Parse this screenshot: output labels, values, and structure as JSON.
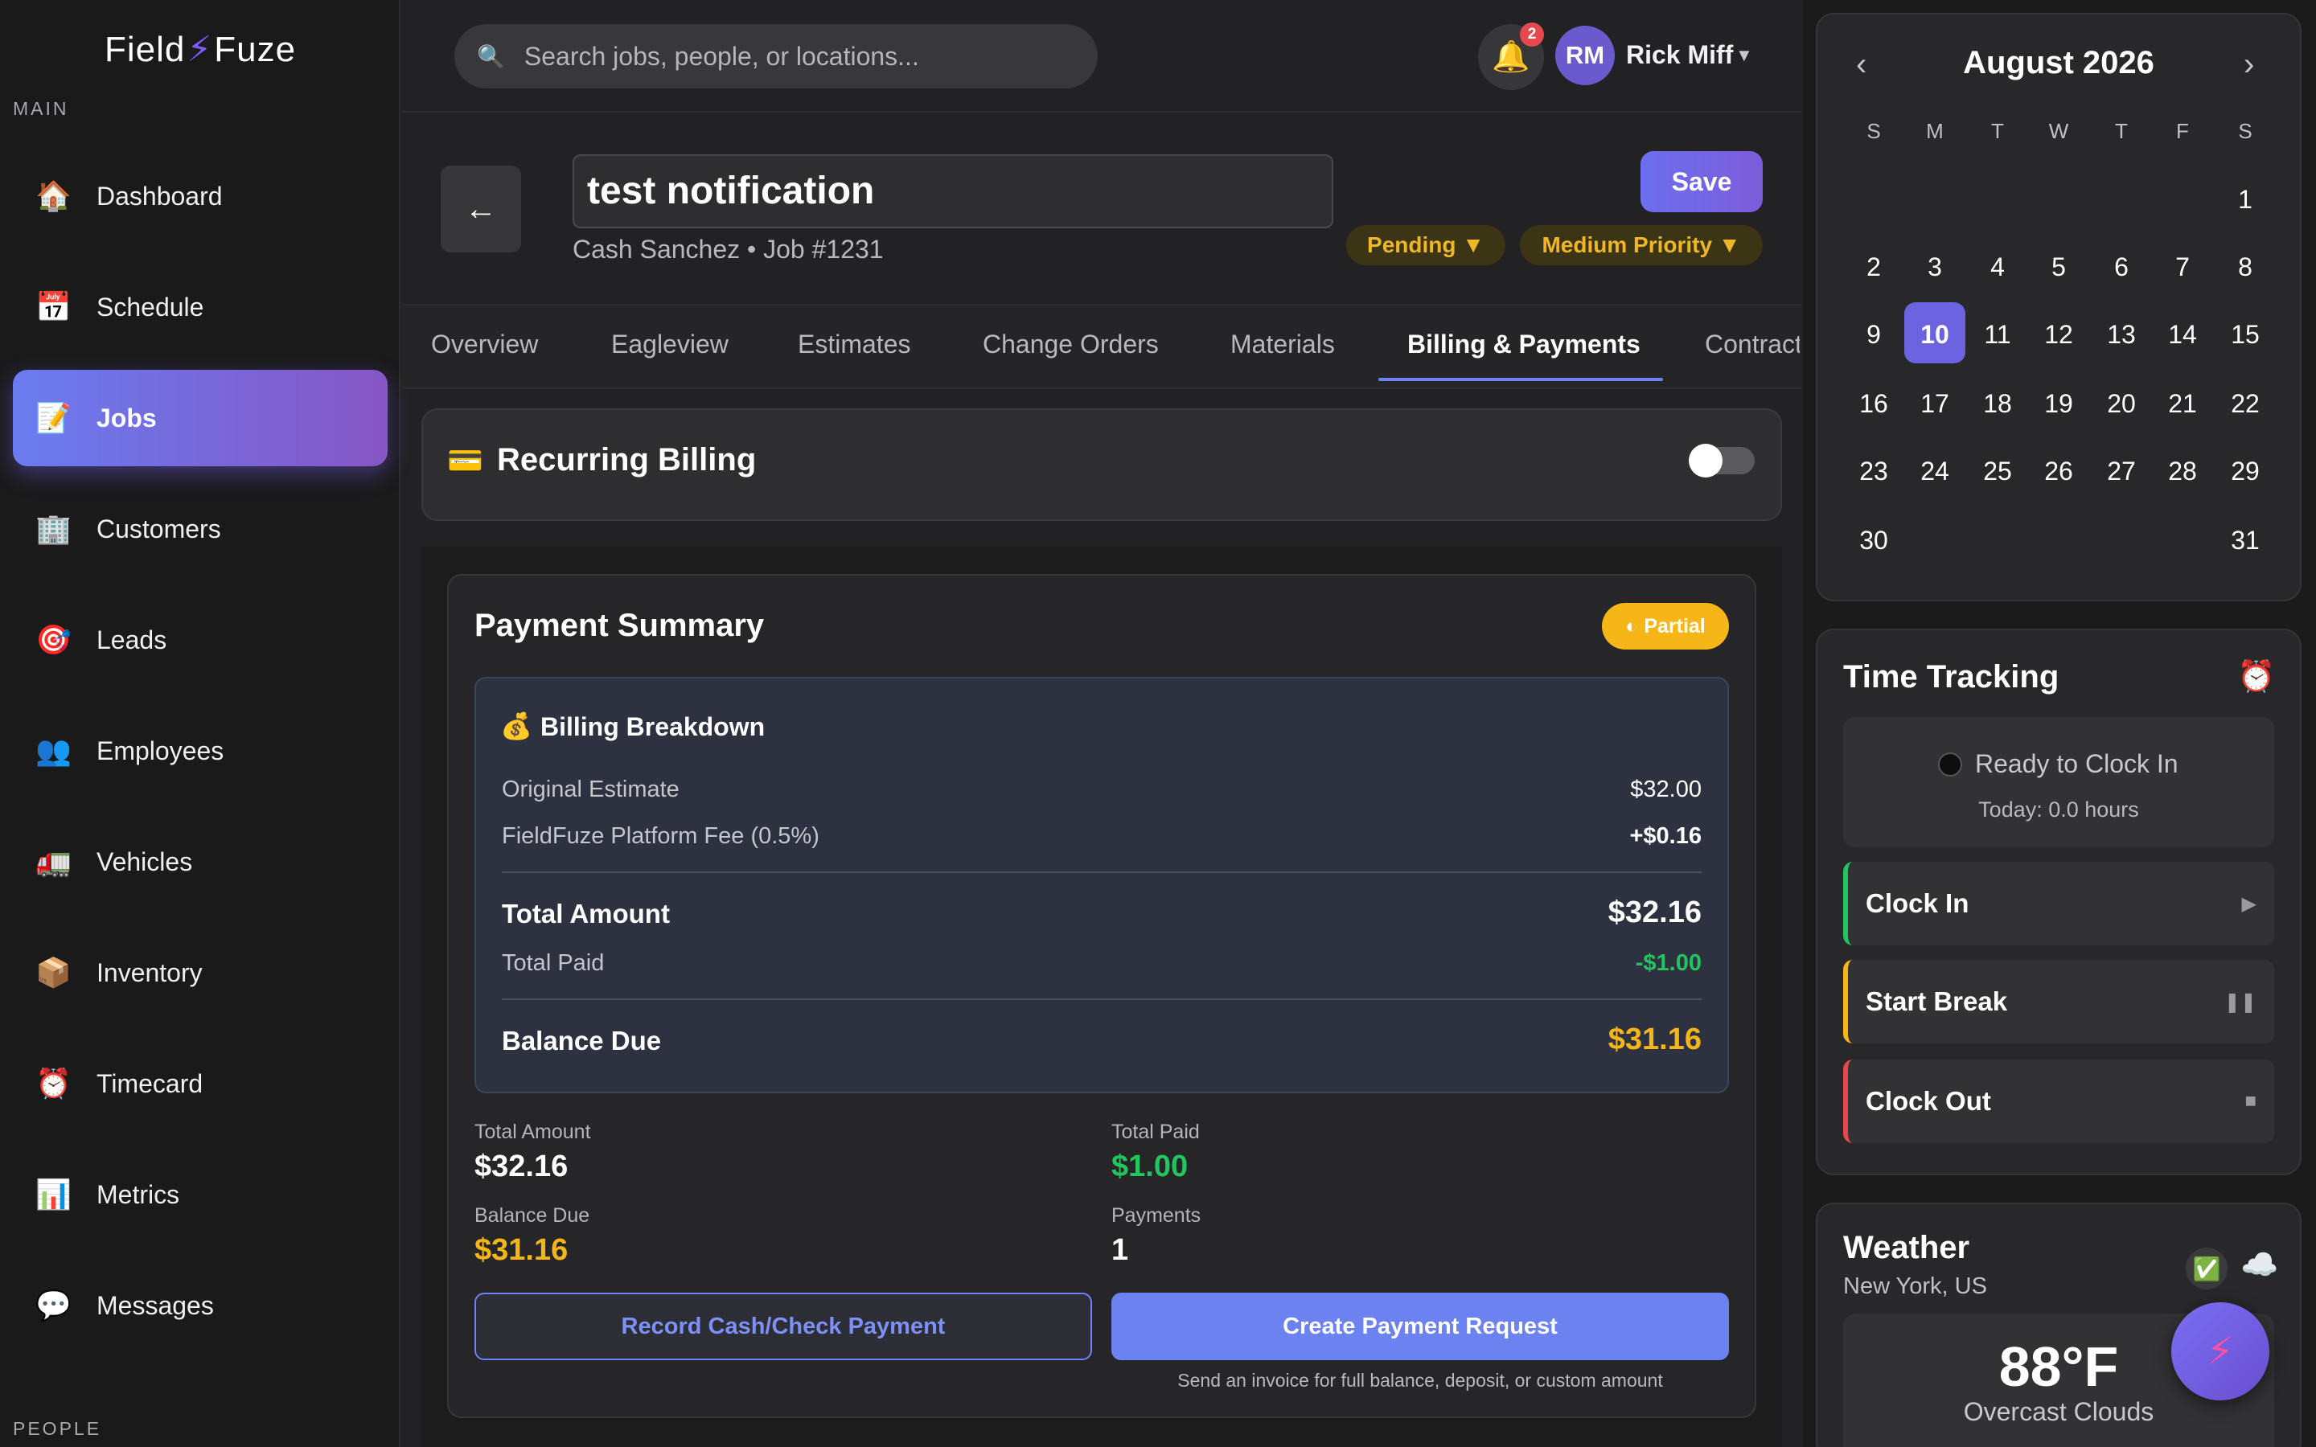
{
  "app": {
    "logo_left": "Field",
    "logo_right": "Fuze"
  },
  "sidebar": {
    "section_main": "MAIN",
    "section_people": "PEOPLE",
    "items": [
      {
        "label": "Dashboard",
        "icon": "house-icon"
      },
      {
        "label": "Schedule",
        "icon": "calendar-icon"
      },
      {
        "label": "Jobs",
        "icon": "memo-icon",
        "active": true
      },
      {
        "label": "Customers",
        "icon": "building-icon"
      },
      {
        "label": "Leads",
        "icon": "target-icon"
      },
      {
        "label": "Employees",
        "icon": "people-icon"
      },
      {
        "label": "Vehicles",
        "icon": "truck-icon"
      },
      {
        "label": "Inventory",
        "icon": "package-icon"
      },
      {
        "label": "Timecard",
        "icon": "alarm-clock-icon"
      },
      {
        "label": "Metrics",
        "icon": "bar-chart-icon"
      },
      {
        "label": "Messages",
        "icon": "speech-bubble-icon"
      }
    ]
  },
  "header": {
    "search_placeholder": "Search jobs, people, or locations...",
    "notification_count": "2",
    "user_initials": "RM",
    "user_name": "Rick Miff"
  },
  "job": {
    "title": "test notification",
    "subtitle": "Cash Sanchez • Job #1231",
    "save_label": "Save",
    "status": "Pending ▼",
    "priority": "Medium Priority ▼"
  },
  "tabs": [
    {
      "label": "Overview"
    },
    {
      "label": "Eagleview"
    },
    {
      "label": "Estimates"
    },
    {
      "label": "Change Orders"
    },
    {
      "label": "Materials"
    },
    {
      "label": "Billing & Payments",
      "active": true
    },
    {
      "label": "Contract"
    }
  ],
  "recurring": {
    "title": "Recurring Billing",
    "enabled": false
  },
  "payment_summary": {
    "title": "Payment Summary",
    "badge": "Partial",
    "breakdown_title": "Billing Breakdown",
    "rows": {
      "original_label": "Original Estimate",
      "original_value": "$32.00",
      "fee_label": "FieldFuze Platform Fee (0.5%)",
      "fee_value": "+$0.16",
      "total_label": "Total Amount",
      "total_value": "$32.16",
      "paid_label": "Total Paid",
      "paid_value": "-$1.00",
      "balance_label": "Balance Due",
      "balance_value": "$31.16"
    },
    "stats": {
      "total_label": "Total Amount",
      "total_value": "$32.16",
      "paid_label": "Total Paid",
      "paid_value": "$1.00",
      "balance_label": "Balance Due",
      "balance_value": "$31.16",
      "payments_label": "Payments",
      "payments_value": "1"
    },
    "record_button": "Record Cash/Check Payment",
    "create_button": "Create Payment Request",
    "hint": "Send an invoice for full balance, deposit, or custom amount"
  },
  "calendar": {
    "month": "August 2026",
    "weekdays": [
      "S",
      "M",
      "T",
      "W",
      "T",
      "F",
      "S"
    ],
    "selected": "10",
    "weeks": [
      [
        "",
        "",
        "",
        "",
        "",
        "",
        "1"
      ],
      [
        "2",
        "3",
        "4",
        "5",
        "6",
        "7",
        "8"
      ],
      [
        "9",
        "10",
        "11",
        "12",
        "13",
        "14",
        "15"
      ],
      [
        "16",
        "17",
        "18",
        "19",
        "20",
        "21",
        "22"
      ],
      [
        "23",
        "24",
        "25",
        "26",
        "27",
        "28",
        "29"
      ],
      [
        "30",
        "",
        "",
        "",
        "",
        "",
        "31"
      ]
    ]
  },
  "time_tracking": {
    "title": "Time Tracking",
    "status": "Ready to Clock In",
    "today": "Today: 0.0 hours",
    "clock_in": "Clock In",
    "start_break": "Start Break",
    "clock_out": "Clock Out"
  },
  "weather": {
    "title": "Weather",
    "location": "New York, US",
    "temperature": "88°F",
    "description": "Overcast Clouds"
  },
  "colors": {
    "accent": "#6b82f0",
    "warning": "#f6b618",
    "success": "#22c55e",
    "danger": "#e5484d"
  }
}
